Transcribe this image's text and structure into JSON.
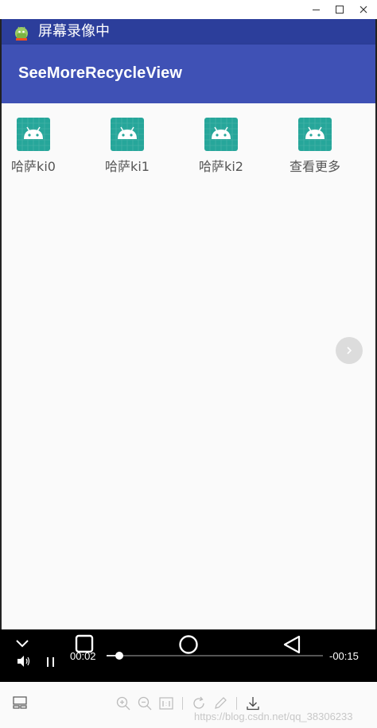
{
  "window": {
    "minimize_glyph": "—",
    "maximize_glyph": "□",
    "close_glyph": "✕"
  },
  "statusbar": {
    "app_icon": "android-icon",
    "title": "屏幕录像中"
  },
  "appbar": {
    "title": "SeeMoreRecycleView",
    "color": "#3f51b5"
  },
  "grid": {
    "items": [
      {
        "label": "哈萨ki0",
        "icon": "android-launcher-icon"
      },
      {
        "label": "哈萨ki1",
        "icon": "android-launcher-icon"
      },
      {
        "label": "哈萨ki2",
        "icon": "android-launcher-icon"
      },
      {
        "label": "查看更多",
        "icon": "android-launcher-icon"
      }
    ]
  },
  "next_button": {
    "icon": "chevron-right-icon"
  },
  "player": {
    "elapsed": "00:02",
    "remaining": "-00:15",
    "progress": 0.06
  },
  "toolbar": {
    "watermark": "https://blog.csdn.net/qq_38306233"
  }
}
